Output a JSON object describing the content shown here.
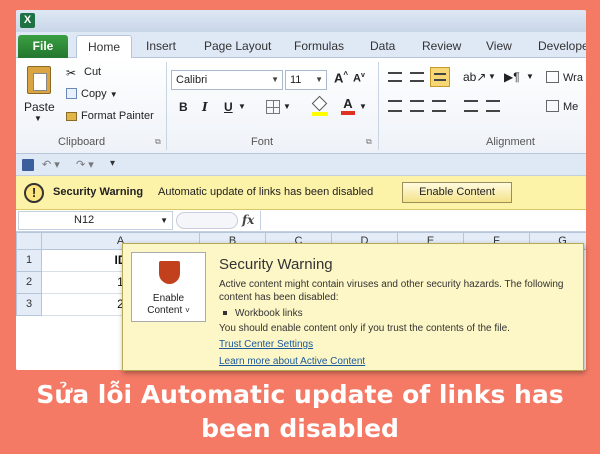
{
  "ribbon_tabs": [
    {
      "label": "File"
    },
    {
      "label": "Home"
    },
    {
      "label": "Insert"
    },
    {
      "label": "Page Layout"
    },
    {
      "label": "Formulas"
    },
    {
      "label": "Data"
    },
    {
      "label": "Review"
    },
    {
      "label": "View"
    },
    {
      "label": "Develope"
    }
  ],
  "clipboard": {
    "paste": "Paste",
    "cut": "Cut",
    "copy": "Copy",
    "format_painter": "Format Painter",
    "group": "Clipboard"
  },
  "font": {
    "name": "Calibri",
    "size": "11",
    "bold": "B",
    "italic": "I",
    "underline": "U",
    "group": "Font"
  },
  "alignment": {
    "wrap": "Wra",
    "merge": "Me",
    "group": "Alignment"
  },
  "message_bar": {
    "title": "Security Warning",
    "text": "Automatic update of links has been disabled",
    "button": "Enable Content"
  },
  "formula_bar": {
    "name_box": "N12",
    "fx": "fx"
  },
  "grid": {
    "columns": [
      "A",
      "B",
      "C",
      "D",
      "E",
      "F",
      "G"
    ],
    "rows": [
      {
        "num": "1",
        "a": "ID"
      },
      {
        "num": "2",
        "a": "1"
      },
      {
        "num": "3",
        "a": "2"
      }
    ]
  },
  "popup": {
    "enable_label_1": "Enable",
    "enable_label_2": "Content",
    "title": "Security Warning",
    "line1": "Active content might contain viruses and other security hazards. The following",
    "line2": "content has been disabled:",
    "bullet": "Workbook links",
    "line3": "You should enable content only if you trust the contents of the file.",
    "link1": "Trust Center Settings",
    "link2": "Learn more about Active Content"
  },
  "caption": {
    "line1": "Sửa lỗi Automatic update of links has",
    "line2": "been disabled"
  },
  "colors": {
    "background": "#F47A66",
    "message_bar": "#FCF2A8",
    "file_tab": "#2E8B3A",
    "shield": "#C2411C"
  }
}
